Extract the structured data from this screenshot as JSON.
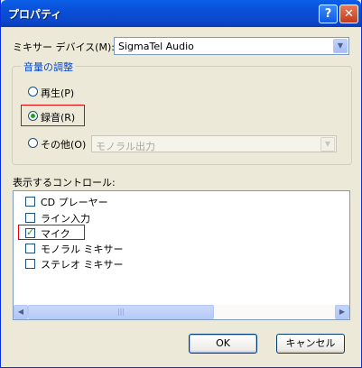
{
  "window": {
    "title": "プロパティ",
    "help_glyph": "?",
    "close_glyph": "✕"
  },
  "mixer_device": {
    "label": "ミキサー デバイス(M):",
    "value": "SigmaTel Audio"
  },
  "volume_group": {
    "title": "音量の調整",
    "options": [
      {
        "label": "再生(P)",
        "selected": false
      },
      {
        "label": "録音(R)",
        "selected": true
      },
      {
        "label": "その他(O)",
        "selected": false
      }
    ],
    "other_select_value": "モノラル出力"
  },
  "controls": {
    "label": "表示するコントロール:",
    "items": [
      {
        "label": "CD プレーヤー",
        "checked": false
      },
      {
        "label": "ライン入力",
        "checked": false
      },
      {
        "label": "マイク",
        "checked": true
      },
      {
        "label": "モノラル ミキサー",
        "checked": false
      },
      {
        "label": "ステレオ ミキサー",
        "checked": false
      }
    ]
  },
  "buttons": {
    "ok": "OK",
    "cancel": "キャンセル"
  },
  "colors": {
    "titlebar": "#0a5fe8",
    "dialog_bg": "#ece9d8",
    "highlight": "#e00000",
    "group_title": "#0046d5"
  }
}
